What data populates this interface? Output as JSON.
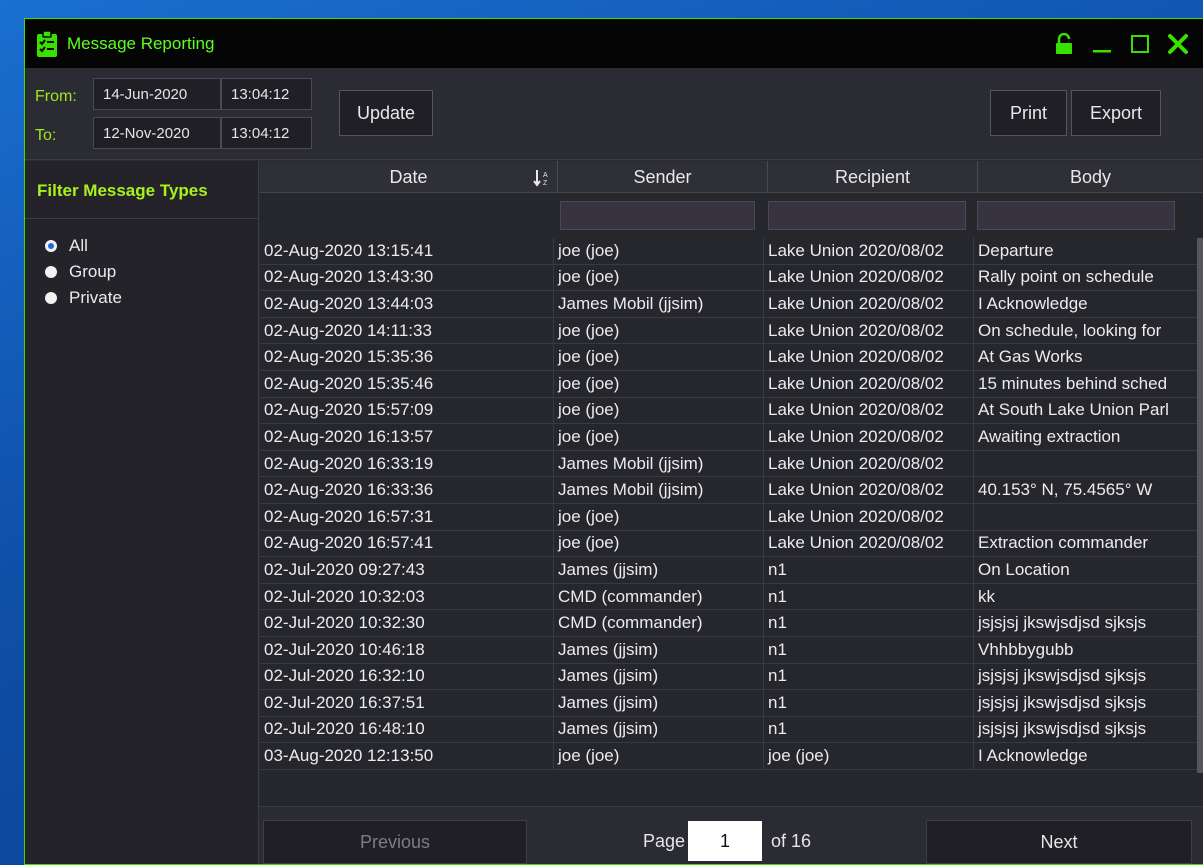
{
  "window": {
    "title": "Message Reporting"
  },
  "colors": {
    "accent": "#39e000",
    "title_green": "#5dff20",
    "label_green": "#9ee81c",
    "radio_selected": "#2068e0"
  },
  "icons": {
    "app": "clipboard-checklist-icon",
    "lock": "unlock-icon",
    "minimize": "minimize-icon",
    "maximize": "maximize-icon",
    "close": "close-icon"
  },
  "range": {
    "from_label": "From:",
    "to_label": "To:",
    "from_date": "14-Jun-2020",
    "from_time": "13:04:12",
    "to_date": "12-Nov-2020",
    "to_time": "13:04:12"
  },
  "toolbar": {
    "update": "Update",
    "print": "Print",
    "export": "Export"
  },
  "sidebar": {
    "title": "Filter Message Types",
    "options": [
      "All",
      "Group",
      "Private"
    ],
    "selected": "All"
  },
  "table": {
    "columns": [
      "Date",
      "Sender",
      "Recipient",
      "Body"
    ],
    "sort_column": "Date",
    "rows": [
      [
        "02-Aug-2020 13:15:41",
        "joe (joe)",
        "Lake Union 2020/08/02",
        "Departure"
      ],
      [
        "02-Aug-2020 13:43:30",
        "joe (joe)",
        "Lake Union 2020/08/02",
        "Rally point on schedule"
      ],
      [
        "02-Aug-2020 13:44:03",
        "James Mobil (jjsim)",
        "Lake Union 2020/08/02",
        "I Acknowledge"
      ],
      [
        "02-Aug-2020 14:11:33",
        "joe (joe)",
        "Lake Union 2020/08/02",
        "On schedule, looking for"
      ],
      [
        "02-Aug-2020 15:35:36",
        "joe (joe)",
        "Lake Union 2020/08/02",
        "At Gas Works"
      ],
      [
        "02-Aug-2020 15:35:46",
        "joe (joe)",
        "Lake Union 2020/08/02",
        "15 minutes behind sched"
      ],
      [
        "02-Aug-2020 15:57:09",
        "joe (joe)",
        "Lake Union 2020/08/02",
        "At South Lake Union Parl"
      ],
      [
        "02-Aug-2020 16:13:57",
        "joe (joe)",
        "Lake Union 2020/08/02",
        "Awaiting extraction"
      ],
      [
        "02-Aug-2020 16:33:19",
        "James Mobil (jjsim)",
        "Lake Union 2020/08/02",
        ""
      ],
      [
        "02-Aug-2020 16:33:36",
        "James Mobil (jjsim)",
        "Lake Union 2020/08/02",
        "40.153° N, 75.4565° W"
      ],
      [
        "02-Aug-2020 16:57:31",
        "joe (joe)",
        "Lake Union 2020/08/02",
        ""
      ],
      [
        "02-Aug-2020 16:57:41",
        "joe (joe)",
        "Lake Union 2020/08/02",
        "Extraction commander"
      ],
      [
        "02-Jul-2020 09:27:43",
        "James (jjsim)",
        "n1",
        "On Location"
      ],
      [
        "02-Jul-2020 10:32:03",
        "CMD (commander)",
        "n1",
        "kk"
      ],
      [
        "02-Jul-2020 10:32:30",
        "CMD (commander)",
        "n1",
        "jsjsjsj jkswjsdjsd sjksjs"
      ],
      [
        "02-Jul-2020 10:46:18",
        "James (jjsim)",
        "n1",
        "Vhhbbygubb"
      ],
      [
        "02-Jul-2020 16:32:10",
        "James (jjsim)",
        "n1",
        "jsjsjsj jkswjsdjsd sjksjs"
      ],
      [
        "02-Jul-2020 16:37:51",
        "James (jjsim)",
        "n1",
        "jsjsjsj jkswjsdjsd sjksjs"
      ],
      [
        "02-Jul-2020 16:48:10",
        "James (jjsim)",
        "n1",
        "jsjsjsj jkswjsdjsd sjksjs"
      ],
      [
        "03-Aug-2020 12:13:50",
        "joe (joe)",
        "joe (joe)",
        "I Acknowledge"
      ]
    ]
  },
  "pagination": {
    "previous": "Previous",
    "next": "Next",
    "page_label": "Page",
    "current_page": "1",
    "of_label": "of 16"
  }
}
